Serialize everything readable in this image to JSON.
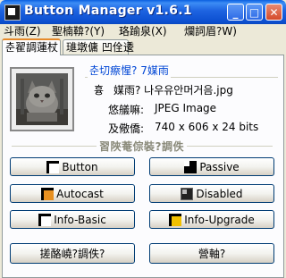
{
  "window": {
    "title": "Button Manager v1.6.1",
    "min_glyph": "_",
    "max_glyph": "□",
    "close_glyph": "✕"
  },
  "menu": [
    {
      "label": "斗雨(Z)"
    },
    {
      "label": "聖楠鞥?(Y)"
    },
    {
      "label": "珞踰泉(X)"
    },
    {
      "label": "爛詞眉?W)"
    }
  ],
  "tabs": [
    {
      "label": "춘翟調蓮杖",
      "active": true
    },
    {
      "label": "璡墩傭 凹佺逶",
      "active": false
    }
  ],
  "file_info": {
    "caption": "춘切瘵惺? 7媒雨",
    "filename_label": "흉",
    "filename_value": "媒雨? 나우유안머거음.jpg",
    "format_label": "悠艤嘛:",
    "format_value": "JPEG Image",
    "size_label": "及儆僑:",
    "size_value": "740 x 606 x 24 bits"
  },
  "section_caption": "習陜菴倧裝?調佚",
  "buttons": [
    {
      "label": "Button",
      "icon": "button-frame-icon"
    },
    {
      "label": "Passive",
      "icon": "passive-frame-icon"
    },
    {
      "label": "Autocast",
      "icon": "autocast-frame-icon"
    },
    {
      "label": "Disabled",
      "icon": "disabled-frame-icon"
    },
    {
      "label": "Info-Basic",
      "icon": "info-basic-frame-icon"
    },
    {
      "label": "Info-Upgrade",
      "icon": "info-upgrade-frame-icon"
    }
  ],
  "bottom_buttons": [
    {
      "label": "搓酪嶢?調佚?"
    },
    {
      "label": "營軸?"
    }
  ]
}
